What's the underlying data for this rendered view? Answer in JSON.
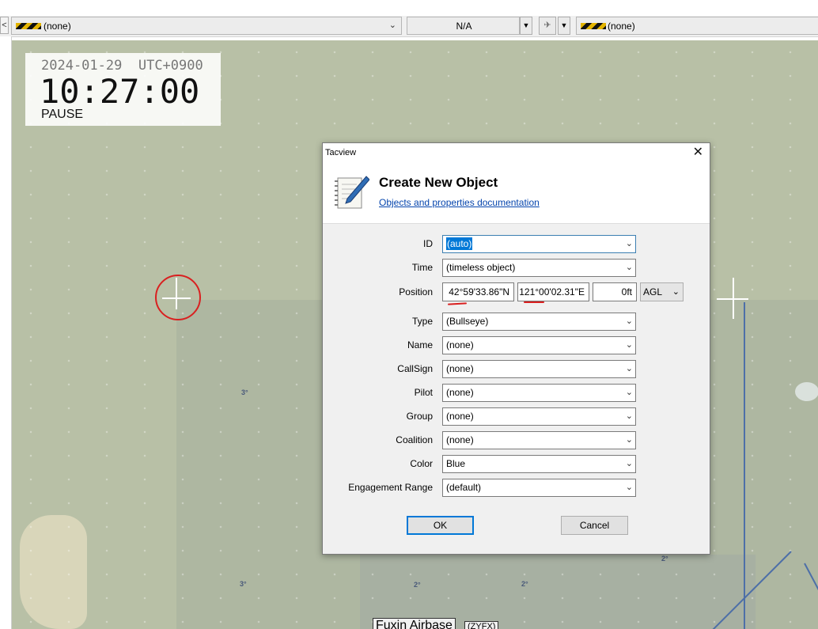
{
  "toolbar": {
    "combo1_value": "(none)",
    "combo2_value": "N/A",
    "combo3_value": "(none)",
    "left_button": "<",
    "colors": {
      "hazard_yellow": "#e3b400",
      "hazard_black": "#111111"
    }
  },
  "clock": {
    "date": "2024-01-29",
    "timezone": "UTC+0900",
    "time": "10:27:00",
    "state": "PAUSE"
  },
  "map": {
    "grid_numbers": [
      "3°",
      "3°",
      "2°",
      "2°",
      "2°"
    ],
    "airbase_label": "Fuxin Airbase",
    "airbase_code": "(ZYFX)"
  },
  "dialog": {
    "window_title": "Tacview",
    "close_label": "✕",
    "heading": "Create New Object",
    "doc_link": "Objects and properties documentation",
    "fields": {
      "id": {
        "label": "ID",
        "value": "(auto)"
      },
      "time": {
        "label": "Time",
        "value": "(timeless object)"
      },
      "position": {
        "label": "Position",
        "latitude": "42°59'33.86\"N",
        "longitude": "121°00'02.31\"E",
        "altitude": "0ft",
        "reference": "AGL"
      },
      "type": {
        "label": "Type",
        "value": "(Bullseye)"
      },
      "name": {
        "label": "Name",
        "value": "(none)"
      },
      "callsign": {
        "label": "CallSign",
        "value": "(none)"
      },
      "pilot": {
        "label": "Pilot",
        "value": "(none)"
      },
      "group": {
        "label": "Group",
        "value": "(none)"
      },
      "coalition": {
        "label": "Coalition",
        "value": "(none)"
      },
      "color": {
        "label": "Color",
        "value": "Blue"
      },
      "engagement_range": {
        "label": "Engagement Range",
        "value": "(default)"
      }
    },
    "ok_label": "OK",
    "cancel_label": "Cancel",
    "icons": {
      "header": "notepad-pen-icon",
      "dropdown": "chevron-down-icon"
    },
    "accent_color": "#0078d7",
    "link_color": "#0645ad",
    "annotation_color": "#d92020"
  }
}
